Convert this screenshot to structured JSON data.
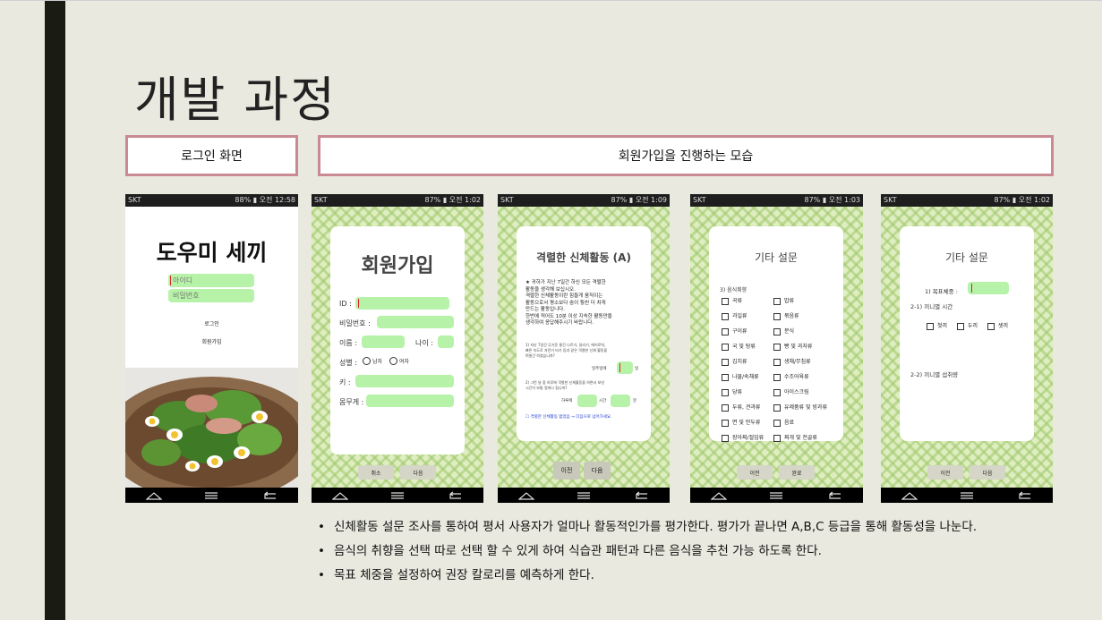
{
  "slide": {
    "title": "개발 과정",
    "captions": {
      "login": "로그인 화면",
      "signup": "회원가입을 진행하는 모습"
    }
  },
  "phones": {
    "status": [
      {
        "carrier": "SKT",
        "right": "88% ▮ 오전 12:58"
      },
      {
        "carrier": "SKT",
        "right": "87% ▮ 오전 1:02"
      },
      {
        "carrier": "SKT",
        "right": "87% ▮ 오전 1:09"
      },
      {
        "carrier": "SKT",
        "right": "87% ▮ 오전 1:03"
      },
      {
        "carrier": "SKT",
        "right": "87% ▮ 오전 1:02"
      }
    ],
    "login": {
      "app_title": "도우미 세끼",
      "id_placeholder": "아이디",
      "pw_placeholder": "비밀번호",
      "login_label": "로그인",
      "signup_label": "회원가입"
    },
    "signup": {
      "title": "회원가입",
      "id": "ID :",
      "pw": "비밀번호 :",
      "name": "이름 :",
      "age": "나이 :",
      "gender": "성별 :",
      "male": "남자",
      "female": "여자",
      "height": "키 :",
      "weight": "몸무게 :",
      "cancel": "취소",
      "next": "다음"
    },
    "activity": {
      "title": "격렬한 신체활동 (A)",
      "intro": [
        "★ 귀하가 지난 7일간 하신 모든 격렬한",
        "활동을 생각해 보십시오.",
        "격렬한 신체활동이란 힘들게 움직이는",
        "활동으로서 평소보다 숨이 훨씬 더 차게",
        "만드는 활동입니다.",
        "한번에 적어도 10분 이상 지속한 활동만을",
        "생각하여 응답해주시기 바랍니다."
      ],
      "q1": [
        "1) 지난 7일간 무거운 물건 나르기, 달리기, 에어로빅,",
        "빠른 속도로 자전거 타기 등과 같은 격렬한 신체 활동을",
        "며칠간 하였습니까?"
      ],
      "q1_unit_prefix": "일주일에",
      "q1_unit": "일",
      "q2": [
        "2) 그런 날 중 하루에 격렬한 신체활동을 하면서 보낸",
        "시간이 보통 얼마나 됩니까?"
      ],
      "q2_prefix": "하루에",
      "q2_hours": "시간",
      "q2_minutes": "분",
      "note": "☐ 격렬한 신체활동 없었음 → 다음으로 넘어가세요.",
      "prev": "이전",
      "next": "다음"
    },
    "survey": {
      "title": "기타 설문",
      "section": "3) 음식취향",
      "left": [
        "곡류",
        "과일류",
        "구이류",
        "국 및 탕류",
        "김치류",
        "나물/숙채류",
        "당류",
        "두류, 견과류",
        "면 및 만두류",
        "장아찌/절임류"
      ],
      "right": [
        "밥류",
        "볶음류",
        "분식",
        "빵 및 과자류",
        "생채/무침류",
        "수조어육류",
        "아이스크림",
        "유제품류 및 빙과류",
        "음료",
        "찌개 및 전골류"
      ],
      "prev": "이전",
      "done": "완료"
    },
    "goal": {
      "title": "기타 설문",
      "weight": "1) 목표체중 :",
      "meal_time": "2-1) 끼니별 시간",
      "meals": [
        "첫끼",
        "두끼",
        "셋끼"
      ],
      "intake": "2-2) 끼니별 섭취량",
      "prev": "이전",
      "next": "다음"
    }
  },
  "bullets": [
    "신체활동 설문 조사를 통하여 평서 사용자가 얼마나 활동적인가를 평가한다. 평가가 끝나면 A,B,C 등급을 통해 활동성을 나눈다.",
    "음식의 취향을 선택 따로 선택 할 수 있게 하여 식습관 패턴과 다른 음식을 추천 가능 하도록 한다.",
    "목표 체중을 설정하여 권장 칼로리를 예측하게 한다."
  ],
  "colors": {
    "caption_border": "#c98a94",
    "field": "#b6f2a8",
    "pattern": "#dfeec0",
    "left_bar": "#1a1c14"
  }
}
